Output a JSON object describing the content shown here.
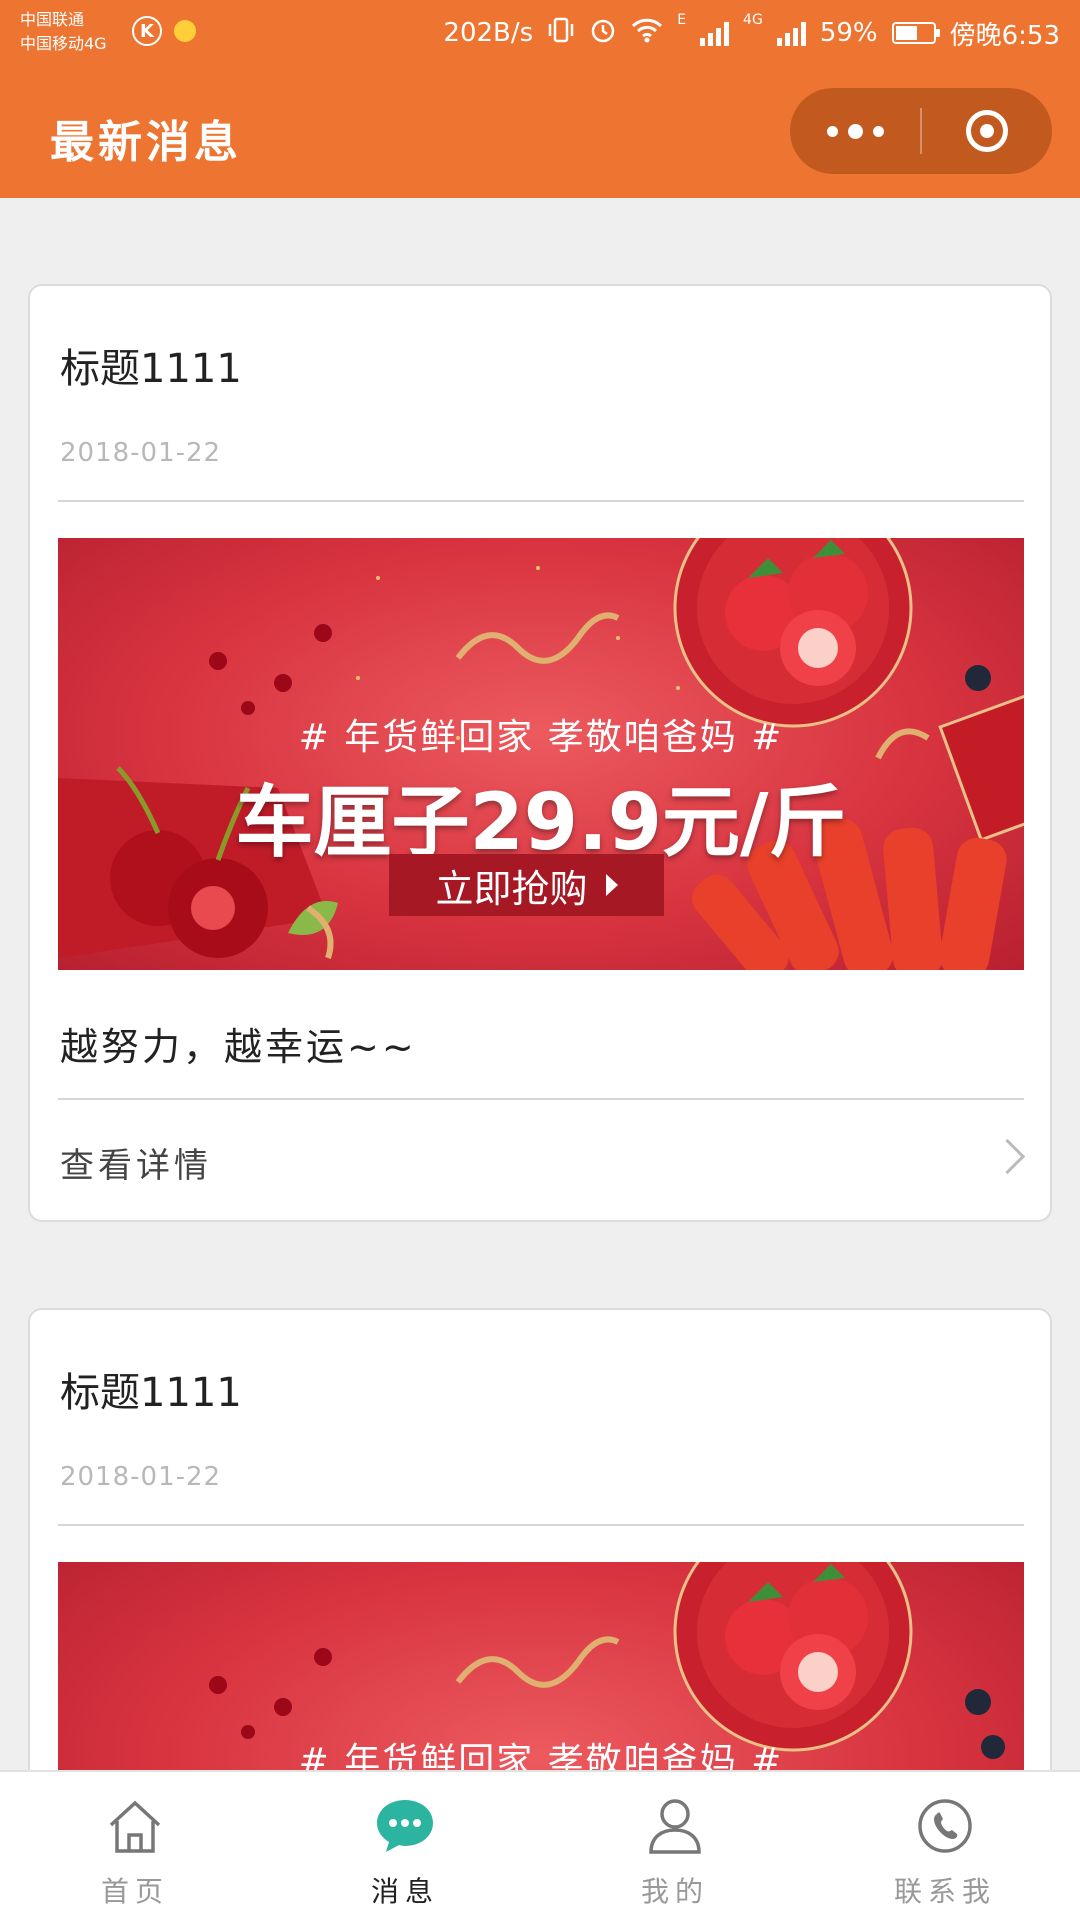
{
  "status_bar": {
    "carrier_1": "中国联通",
    "carrier_2": "中国移动4G",
    "badge_letter": "K",
    "speed": "202B/s",
    "network_e": "E",
    "network_4g": "4G",
    "battery_percent": "59%",
    "battery_level": 0.59,
    "time": "傍晚6:53"
  },
  "navbar": {
    "title": "最新消息"
  },
  "cards": [
    {
      "title": "标题1111",
      "date": "2018-01-22",
      "banner": {
        "subtitle": "# 年货鲜回家  孝敬咱爸妈 #",
        "headline": "车厘子29.9元/斤",
        "cta": "立即抢购"
      },
      "text": "越努力，越幸运~~",
      "details_label": "查看详情"
    },
    {
      "title": "标题1111",
      "date": "2018-01-22",
      "banner": {
        "subtitle": "# 年货鲜回家  孝敬咱爸妈 #"
      }
    }
  ],
  "tabbar": {
    "items": [
      {
        "label": "首页",
        "icon": "home-icon",
        "active": false
      },
      {
        "label": "消息",
        "icon": "message-icon",
        "active": true
      },
      {
        "label": "我的",
        "icon": "user-icon",
        "active": false
      },
      {
        "label": "联系我",
        "icon": "phone-icon",
        "active": false
      }
    ]
  },
  "colors": {
    "primary": "#ed7431",
    "capsule": "#c25a1f",
    "active_tab_icon": "#2bb5a0",
    "banner_red": "#d83440"
  }
}
